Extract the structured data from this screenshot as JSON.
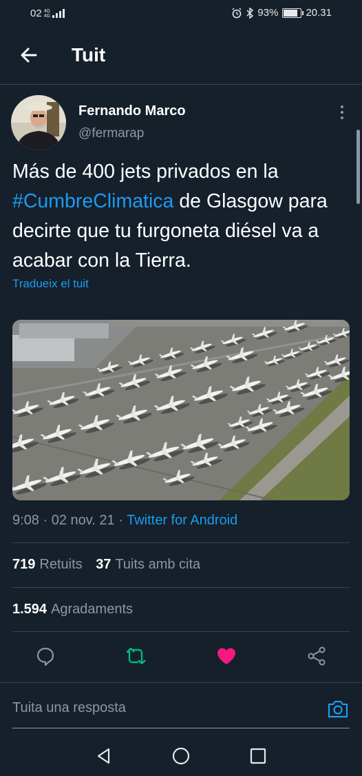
{
  "status_bar": {
    "carrier": "02",
    "network": "4G",
    "network_sub": "4G",
    "battery_text": "93%",
    "battery_level": 0.93,
    "time": "20.31"
  },
  "header": {
    "title": "Tuit"
  },
  "tweet": {
    "author_name": "Fernando Marco",
    "author_handle": "@fermarap",
    "text_before": "Más de 400 jets privados en la ",
    "hashtag": "#CumbreClimatica",
    "text_after": " de Glasgow para decirte que tu furgoneta diésel va a acabar con la Tierra.",
    "translate_label": "Tradueix el tuit",
    "time": "9:08",
    "date": "02 nov. 21",
    "separator": " · ",
    "source": "Twitter for Android",
    "retweets_count": "719",
    "retweets_label": "Retuits",
    "quotes_count": "37",
    "quotes_label": "Tuits amb cita",
    "likes_count": "1.594",
    "likes_label": "Agradaments",
    "liked": true,
    "retweeted": false
  },
  "reply": {
    "placeholder": "Tuita una resposta"
  },
  "colors": {
    "background": "#15202b",
    "accent": "#1d9bf0",
    "secondary_text": "#8b98a5",
    "divider": "#38444d",
    "retweet_icon": "#00ba7c",
    "like_icon": "#f91880"
  },
  "icons": {
    "back": "arrow-left-icon",
    "more": "more-vertical-icon",
    "reply": "comment-icon",
    "retweet": "retweet-icon",
    "like": "heart-icon",
    "share": "share-icon",
    "camera": "camera-icon",
    "nav_back": "triangle-back-icon",
    "nav_home": "circle-home-icon",
    "nav_recents": "square-recents-icon"
  }
}
